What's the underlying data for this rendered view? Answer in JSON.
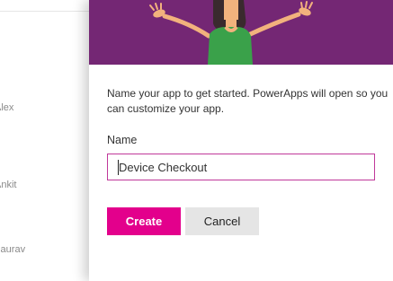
{
  "background_list": {
    "names": [
      "Alex",
      "Ankit",
      "Gaurav"
    ]
  },
  "dialog": {
    "description": "Name your app to get started. PowerApps will open so you can customize your app.",
    "name_label": "Name",
    "name_value": "Device Checkout",
    "create_label": "Create",
    "cancel_label": "Cancel"
  },
  "colors": {
    "hero_background": "#742774",
    "accent": "#e3008c",
    "input_border": "#c0389a",
    "cancel_background": "#e5e5e5"
  }
}
